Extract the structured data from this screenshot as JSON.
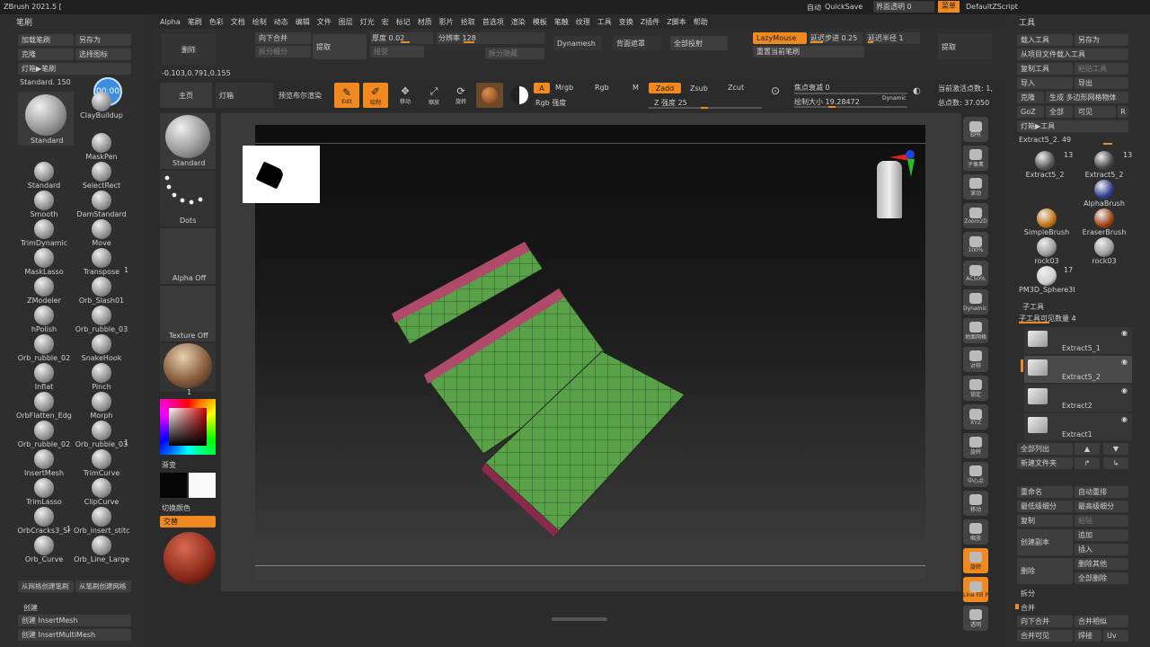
{
  "titlebar": {
    "app": "ZBrush 2021.5 [",
    "autosave": "自动",
    "quicksave": "QuickSave",
    "transparency": "界面透明 0",
    "menus_btn": "菜单",
    "script": "DefaultZScript"
  },
  "menubar": [
    "Alpha",
    "笔刷",
    "色彩",
    "文档",
    "绘制",
    "动态",
    "编辑",
    "文件",
    "图层",
    "灯光",
    "宏",
    "标记",
    "材质",
    "影片",
    "拾取",
    "首选项",
    "渲染",
    "模板",
    "笔触",
    "纹理",
    "工具",
    "变换",
    "Z插件",
    "Z脚本",
    "帮助"
  ],
  "left_panel": {
    "title": "笔刷",
    "load": "加载笔刷",
    "save_as": "另存为",
    "clone": "克隆",
    "select_icon": "选择图标",
    "lightbox_brush": "灯箱▶笔刷",
    "current": "Standard. 150",
    "timer": "00:00",
    "brushes": [
      "Clay",
      "Standard",
      "ClayBuildup",
      "MaskPen",
      "Standard",
      "SelectRect",
      "Smooth",
      "DamStandard",
      "TrimDynamic",
      "Move",
      "MaskLasso",
      "Transpose",
      "ZModeler",
      "Orb_Slash01",
      "hPolish",
      "Orb_rubble_03",
      "Orb_rubble_02",
      "SnakeHook",
      "Inflat",
      "Pinch",
      "OrbFlatten_Edge",
      "Morph",
      "Orb_rubble_02",
      "Orb_rubble_03",
      "InsertMesh",
      "TrimCurve",
      "TrimLasso",
      "ClipCurve",
      "OrbCracks3_Sr",
      "Orb_insert_stitc",
      "Orb_Curve",
      "Orb_Line_Large"
    ],
    "badges": {
      "movelasso": "1",
      "insert": "1",
      "stitch": "1"
    },
    "from_mesh": "从网格创建笔刷",
    "from_brush": "从笔刷创建网格",
    "create_section": "创建",
    "create_insertmesh": "创建 InsertMesh",
    "create_insertmultimesh": "创建 InsertMultiMesh"
  },
  "toolbar": {
    "delete": "删除",
    "merge_down": "向下合并",
    "split_small": "拆分细分",
    "extract": "提取",
    "thickness": "厚度 0.02",
    "resolution": "分辨率 128",
    "accept": "接受",
    "split_hidden": "拆分隐藏",
    "dynamesh": "Dynamesh",
    "backface": "背面遮罩",
    "project_all": "全部投射",
    "lazymouse": "LazyMouse",
    "lazystep": "延迟步进 0.25",
    "lazyradius": "延迟半径 1",
    "replay": "重置当前笔刷",
    "extract2": "提取",
    "coords": "-0.103,0.791,0.155",
    "home": "主页",
    "lightbox": "灯箱",
    "bpr": "预览布尔渲染",
    "edit": "Edit",
    "draw": "绘制",
    "move": "移动",
    "scale": "缩放",
    "rotate": "旋转",
    "a_btn": "A",
    "mrgb": "Mrgb",
    "rgb": "Rgb",
    "m": "M",
    "zadd": "Zadd",
    "zsub": "Zsub",
    "zcut": "Zcut",
    "rgb_intensity": "Rgb 强度",
    "z_intensity": "Z 强度 25",
    "focal": "焦点衰减 0",
    "draw_size": "绘制大小 19.28472",
    "dynamic": "Dynamic",
    "active_points": "当前激活点数: 1,",
    "total_points": "总点数: 37.050"
  },
  "tray": {
    "standard": "Standard",
    "dots": "Dots",
    "alpha_off": "Alpha Off",
    "texture_off": "Texture Off",
    "material_num": "1",
    "gradient": "渐变",
    "switch_color": "切换颜色",
    "alternate": "交替"
  },
  "right_shelf": [
    "BPR",
    "子像素",
    "滚动",
    "Zoom2D",
    "100%",
    "AC50%",
    "Dynamic 透视",
    "地面网格",
    "对称",
    "锁定",
    "XYZ",
    "旋转",
    "中心点",
    "移动",
    "缩放",
    "旋转",
    "Line Fill PolyF",
    "透明"
  ],
  "tool_panel": {
    "title": "工具",
    "load": "载入工具",
    "save_as": "另存为",
    "import_proj": "从项目文件载入工具",
    "copy": "复制工具",
    "paste": "粘贴工具",
    "import": "导入",
    "export": "导出",
    "clone": "克隆",
    "make_polymesh": "生成 多边形网格物体",
    "goz": "GoZ",
    "all": "全部",
    "visible": "可见",
    "r": "R",
    "lightbox_tool": "灯箱▶工具",
    "current": "Extract5_2. 49",
    "tools": [
      "Extract5_2",
      "Extract5_2",
      "AlphaBrush",
      "SimpleBrush",
      "EraserBrush",
      "rock03",
      "rock03",
      "PM3D_Sphere3D"
    ],
    "counts": {
      "t1": "13",
      "t2": "13",
      "t3": "17"
    },
    "subtool_title": "子工具",
    "subtool_count": "子工具可见数量 4",
    "subtools": [
      "Extract5_1",
      "Extract5_2",
      "Extract2",
      "Extract1"
    ],
    "list_all": "全部列出",
    "new_folder": "新建文件夹",
    "rename": "重命名",
    "auto_reorder": "自动重排",
    "lowest": "最低级细分",
    "highest": "最高级细分",
    "dup": "复制",
    "paste2": "粘贴",
    "copy_append": "创建副本",
    "append": "追加",
    "insert": "插入",
    "delete": "删除",
    "del_other": "删除其他",
    "del_all": "全部删除",
    "split": "拆分",
    "merge": "合并",
    "merge_down": "向下合并",
    "merge_similar": "合并相似",
    "merge_visible": "合并可见",
    "weld": "焊接",
    "uv": "Uv"
  }
}
